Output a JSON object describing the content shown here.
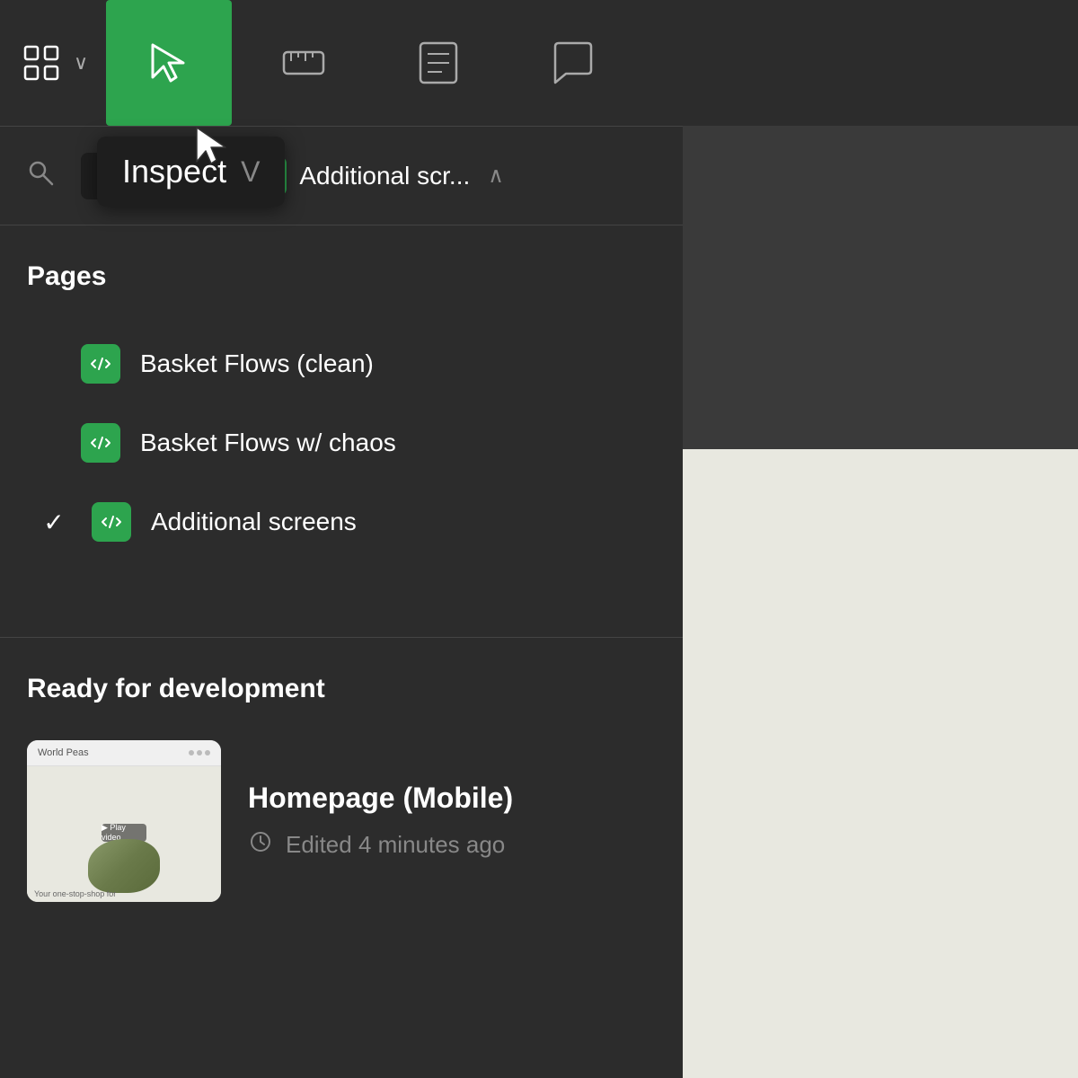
{
  "toolbar": {
    "logo_label": "Figma logo",
    "chevron": "›",
    "inspect_tooltip": {
      "label": "Inspect",
      "shortcut": "V"
    },
    "icons": {
      "inspect": "inspect-icon",
      "ruler": "ruler-icon",
      "document": "document-icon",
      "comment": "comment-icon"
    }
  },
  "panel": {
    "search_placeholder": "Search",
    "current_tab": {
      "label": "Inspect",
      "shortcut": "V"
    },
    "additional_tab": {
      "label": "Additional scr...",
      "chevron": "∧"
    }
  },
  "pages_section": {
    "title": "Pages",
    "items": [
      {
        "label": "Basket Flows (clean)",
        "selected": false,
        "has_check": false
      },
      {
        "label": "Basket Flows w/ chaos",
        "selected": false,
        "has_check": false
      },
      {
        "label": "Additional screens",
        "selected": true,
        "has_check": true
      }
    ]
  },
  "ready_section": {
    "title": "Ready for development",
    "card": {
      "title": "Homepage (Mobile)",
      "meta": "Edited 4 minutes ago",
      "thumb_title": "World Peas",
      "thumb_footer": "Your one-stop-shop for"
    }
  }
}
